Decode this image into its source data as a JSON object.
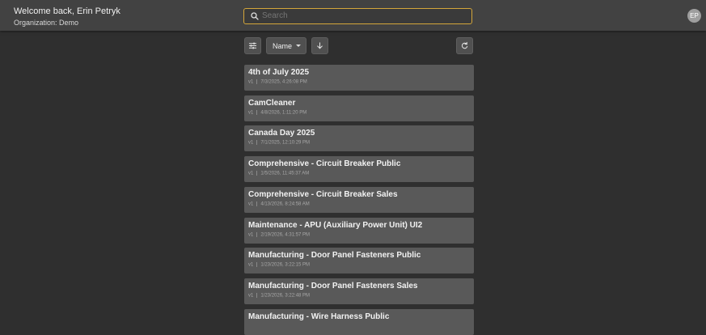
{
  "header": {
    "welcome": "Welcome back, Erin Petryk",
    "organization": "Organization: Demo",
    "search_placeholder": "Search",
    "avatar_initials": "EP"
  },
  "toolbar": {
    "filter_icon": "tune-icon",
    "sort_label": "Name",
    "direction_icon": "arrow-down-icon",
    "refresh_icon": "refresh-icon"
  },
  "colors": {
    "accent": "#d4a63a",
    "card": "#595959",
    "background": "#2f2f2f"
  },
  "items": [
    {
      "title": "4th of July 2025",
      "version": "v1",
      "date": "7/3/2025, 4:26:08 PM"
    },
    {
      "title": "CamCleaner",
      "version": "v1",
      "date": "4/8/2026, 1:11:20 PM"
    },
    {
      "title": "Canada Day 2025",
      "version": "v1",
      "date": "7/1/2025, 12:10:29 PM"
    },
    {
      "title": "Comprehensive - Circuit Breaker Public",
      "version": "v1",
      "date": "1/5/2026, 11:45:37 AM"
    },
    {
      "title": "Comprehensive - Circuit Breaker Sales",
      "version": "v1",
      "date": "4/13/2026, 8:24:58 AM"
    },
    {
      "title": "Maintenance - APU (Auxiliary Power Unit) UI2",
      "version": "v1",
      "date": "2/19/2026, 4:31:57 PM"
    },
    {
      "title": "Manufacturing - Door Panel Fasteners Public",
      "version": "v1",
      "date": "1/23/2026, 3:22:15 PM"
    },
    {
      "title": "Manufacturing - Door Panel Fasteners Sales",
      "version": "v1",
      "date": "1/23/2026, 3:22:48 PM"
    },
    {
      "title": "Manufacturing - Wire Harness Public",
      "version": "",
      "date": ""
    }
  ]
}
